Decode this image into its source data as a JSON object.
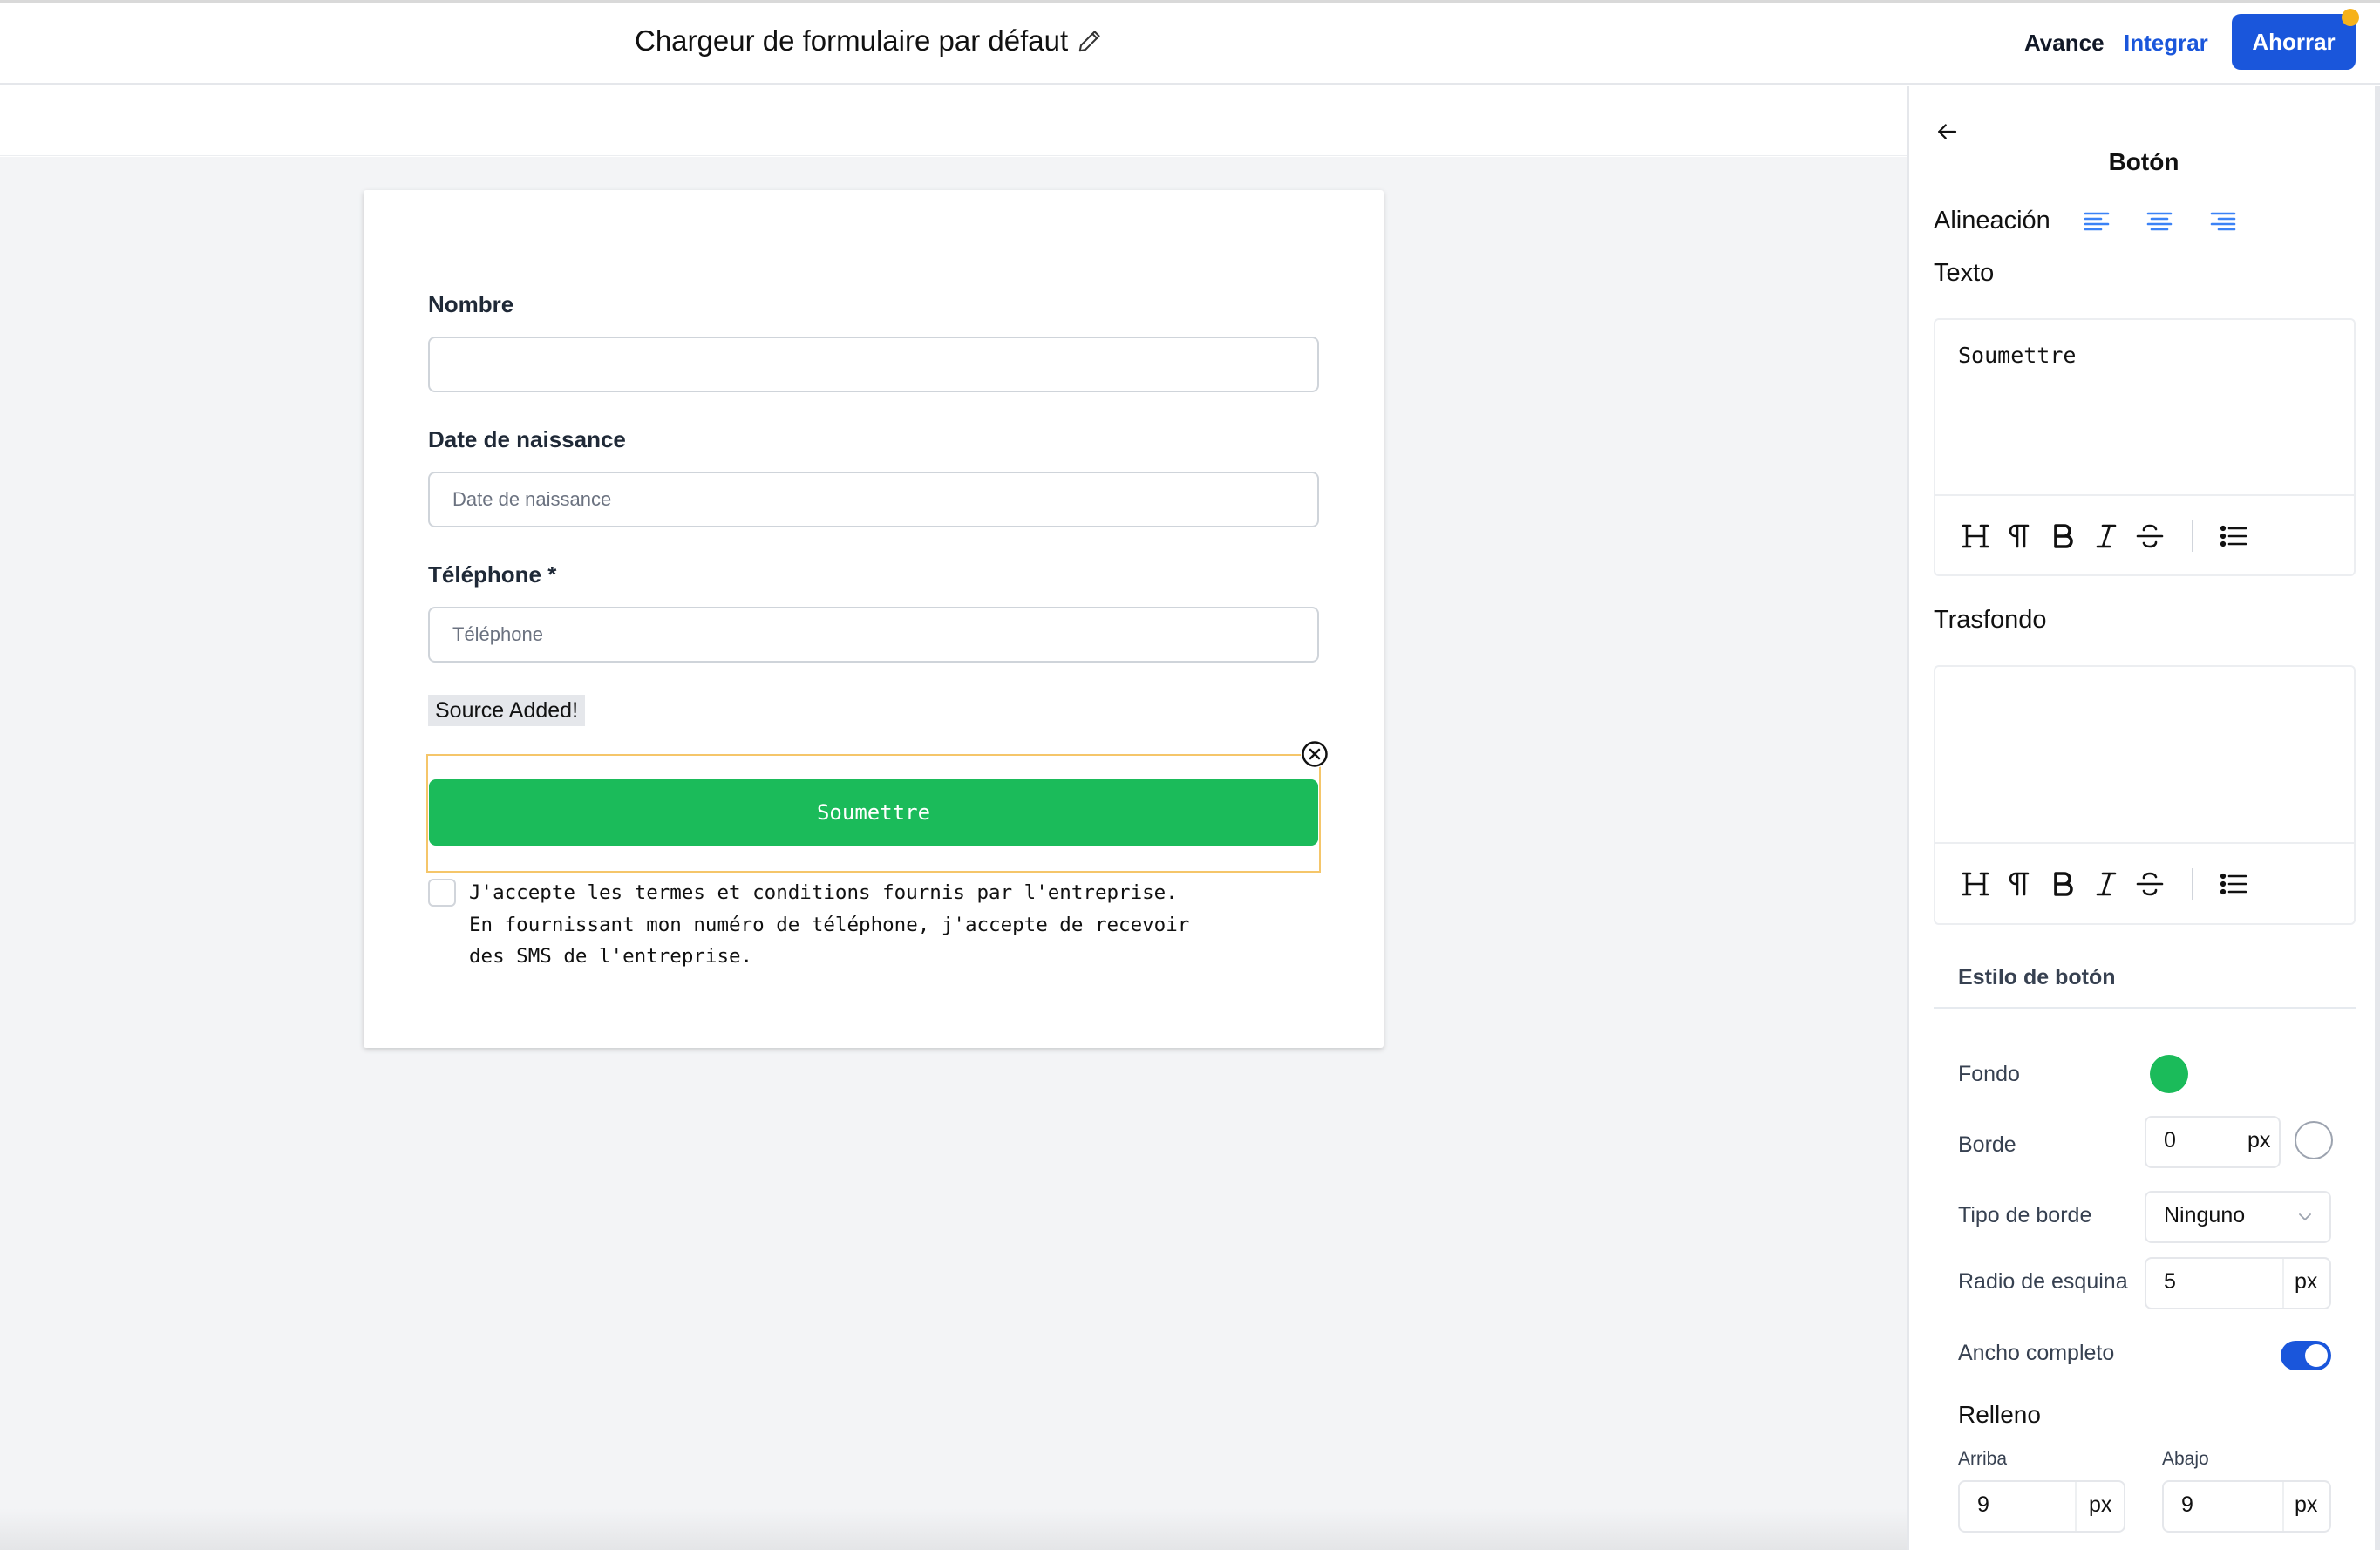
{
  "header": {
    "title": "Chargeur de formulaire par défaut",
    "avance": "Avance",
    "integrar": "Integrar",
    "save": "Ahorrar"
  },
  "form": {
    "fields": [
      {
        "label": "Nombre",
        "placeholder": "",
        "value": ""
      },
      {
        "label": "Date de naissance",
        "placeholder": "Date de naissance",
        "value": ""
      },
      {
        "label": "Téléphone *",
        "placeholder": "Téléphone",
        "value": ""
      }
    ],
    "source_tag": "Source Added!",
    "submit_label": "Soumettre",
    "terms_lines": [
      "J'accepte les termes et conditions fournis par l'entreprise.",
      "En fournissant mon numéro de téléphone, j'accepte de recevoir",
      "des SMS de l'entreprise."
    ],
    "terms_checked": false
  },
  "panel": {
    "title": "Botón",
    "alignment_label": "Alineación",
    "alignment_icons": [
      "align-left-icon",
      "align-center-icon",
      "align-right-icon"
    ],
    "text_label": "Texto",
    "text_value": "Soumettre",
    "background_label": "Trasfondo",
    "background_value": "",
    "toolbar_icons": [
      "heading-icon",
      "paragraph-icon",
      "bold-icon",
      "italic-icon",
      "strikethrough-icon",
      "bullet-list-icon"
    ],
    "button_style": {
      "heading": "Estilo de botón",
      "fondo_label": "Fondo",
      "fondo_color": "#1bbb5a",
      "borde_label": "Borde",
      "borde_value": "0",
      "borde_unit": "px",
      "borde_color": "#ffffff",
      "tipo_label": "Tipo de borde",
      "tipo_value": "Ninguno",
      "radio_label": "Radio de esquina",
      "radio_value": "5",
      "radio_unit": "px",
      "ancho_label": "Ancho completo",
      "ancho_on": true,
      "relleno_label": "Relleno",
      "arriba_label": "Arriba",
      "arriba_value": "9",
      "abajo_label": "Abajo",
      "abajo_value": "9",
      "unit": "px"
    }
  },
  "colors": {
    "accent": "#1a56db",
    "submit_green": "#1bbb5a",
    "notification_dot": "#f6b21a",
    "selection_outline": "#f5c66a"
  }
}
